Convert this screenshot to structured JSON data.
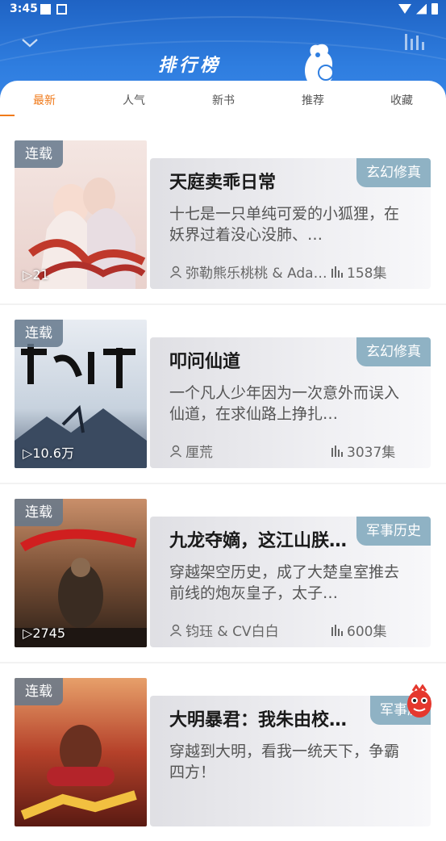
{
  "status_bar": {
    "time": "3:45"
  },
  "header": {
    "title": "排行榜"
  },
  "tabs": [
    {
      "label": "最新",
      "active": true
    },
    {
      "label": "人气",
      "active": false
    },
    {
      "label": "新书",
      "active": false
    },
    {
      "label": "推荐",
      "active": false
    },
    {
      "label": "收藏",
      "active": false
    }
  ],
  "books": [
    {
      "badge": "连载",
      "plays": "21",
      "title": "天庭卖乖日常",
      "tag": "玄幻修真",
      "desc": "十七是一只单纯可爱的小狐狸，在妖界过着没心没肺、…",
      "author": "弥勒熊乐桃桃 & Ada…",
      "episodes": "158集"
    },
    {
      "badge": "连载",
      "plays": "10.6万",
      "title": "叩问仙道",
      "tag": "玄幻修真",
      "desc": "一个凡人少年因为一次意外而误入仙道，在求仙路上挣扎…",
      "author": "厘荒",
      "episodes": "3037集"
    },
    {
      "badge": "连载",
      "plays": "2745",
      "title": "九龙夺嫡，这江山朕…",
      "tag": "军事历史",
      "desc": "穿越架空历史，成了大楚皇室推去前线的炮灰皇子，太子…",
      "author": "钧珏 & CV白白",
      "episodes": "600集"
    },
    {
      "badge": "连载",
      "plays": "",
      "title": "大明暴君：我朱由校…",
      "tag": "军事历",
      "desc": "穿越到大明，看我一统天下，争霸四方！",
      "author": "",
      "episodes": ""
    }
  ],
  "colors": {
    "header_blue": "#2f7ee0",
    "accent": "#f07a1a",
    "tag_bg": "#8fb2c4"
  }
}
